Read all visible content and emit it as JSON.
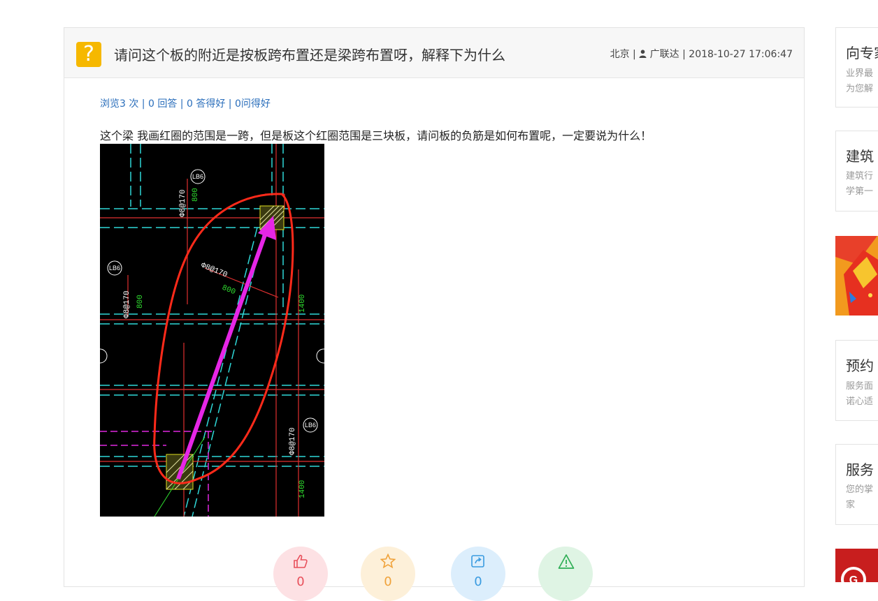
{
  "question": {
    "icon_glyph": "?",
    "title": "请问这个板的附近是按板跨布置还是梁跨布置呀，解释下为什么",
    "meta": {
      "location": "北京",
      "separator": " | ",
      "user_icon": "person-icon",
      "user": "广联达",
      "datetime": "2018-10-27 17:06:47"
    },
    "stats": {
      "views": "浏览3 次",
      "answers": "0 回答",
      "good_answers": "0 答得好",
      "good_questions": "0问得好",
      "separator": " | "
    },
    "body_text": "这个梁 我画红圈的范围是一跨，但是板这个红圈范围是三块板，请问板的负筋是如何布置呢，一定要说为什么！",
    "image": {
      "labels": {
        "lb6_tag": "LB6",
        "rebar_spec": "8@170",
        "rebar_spec_full": "Φ8@170",
        "length_800": "800",
        "length_1400": "1400"
      }
    },
    "actions": [
      {
        "name": "like",
        "icon": "thumbs-up-icon",
        "count": "0",
        "color": "#e8505b"
      },
      {
        "name": "favorite",
        "icon": "star-icon",
        "count": "0",
        "color": "#f0a23a"
      },
      {
        "name": "share",
        "icon": "share-icon",
        "count": "0",
        "color": "#3a9be0"
      },
      {
        "name": "report",
        "icon": "warning-icon",
        "count": "",
        "color": "#2fae55"
      }
    ]
  },
  "sidebar": {
    "cards": [
      {
        "title": "向专家",
        "desc_1": "业界最",
        "desc_2": "为您解"
      },
      {
        "title": "建筑",
        "desc_1": "建筑行",
        "desc_2": "学第一"
      },
      {
        "title": "预约",
        "desc_1": "服务面",
        "desc_2": "诺心适"
      },
      {
        "title": "服务",
        "desc_1": "您的掌",
        "desc_2": "家"
      }
    ],
    "banners": [
      {
        "name": "promo-banner-top",
        "color": "#e8402a"
      },
      {
        "name": "promo-banner-bottom",
        "color": "#c81e1e",
        "logo_glyph": "G"
      }
    ]
  },
  "colors": {
    "accent_blue": "#2a6ebb",
    "question_yellow": "#f6b800",
    "border": "#e3e3e3"
  }
}
